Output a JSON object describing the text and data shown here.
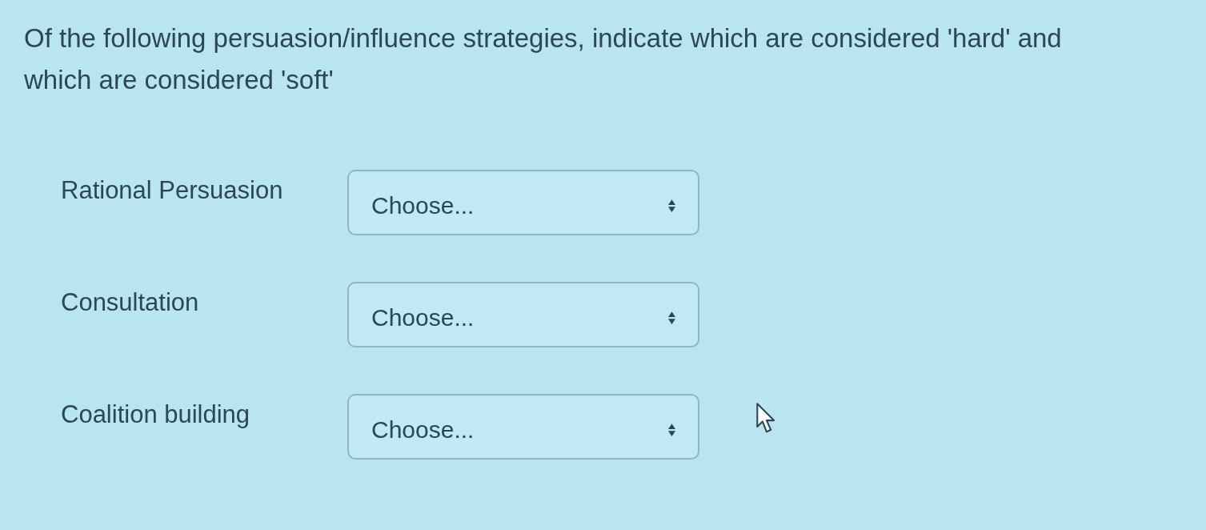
{
  "question": {
    "text": "Of the following persuasion/influence strategies, indicate which are considered 'hard' and which are considered 'soft'"
  },
  "rows": [
    {
      "label": "Rational Persuasion",
      "dropdown": {
        "value": "Choose..."
      }
    },
    {
      "label": "Consultation",
      "dropdown": {
        "value": "Choose..."
      }
    },
    {
      "label": "Coalition building",
      "dropdown": {
        "value": "Choose..."
      }
    }
  ]
}
